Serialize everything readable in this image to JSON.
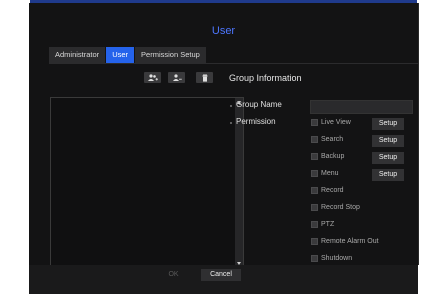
{
  "dialog": {
    "title": "User"
  },
  "tabs": [
    {
      "label": "Administrator",
      "active": false
    },
    {
      "label": "User",
      "active": true
    },
    {
      "label": "Permission Setup",
      "active": false
    }
  ],
  "toolbar": {
    "icons": [
      "add-group-icon",
      "remove-group-icon",
      "trash-icon"
    ]
  },
  "group_list": {
    "items": []
  },
  "group_info": {
    "title": "Group Information",
    "group_name_label": "Group Name",
    "group_name_value": "",
    "permission_label": "Permission"
  },
  "permissions": [
    {
      "label": "Live View",
      "checked": false,
      "setup": "Setup"
    },
    {
      "label": "Search",
      "checked": false,
      "setup": "Setup"
    },
    {
      "label": "Backup",
      "checked": false,
      "setup": "Setup"
    },
    {
      "label": "Menu",
      "checked": false,
      "setup": "Setup"
    },
    {
      "label": "Record",
      "checked": false
    },
    {
      "label": "Record Stop",
      "checked": false
    },
    {
      "label": "PTZ",
      "checked": false
    },
    {
      "label": "Remote Alarm Out",
      "checked": false
    },
    {
      "label": "Shutdown",
      "checked": false
    }
  ],
  "footer": {
    "ok_label": "OK",
    "cancel_label": "Cancel"
  },
  "colors": {
    "accent": "#2563eb",
    "title": "#4d76ff",
    "background": "#131314"
  }
}
